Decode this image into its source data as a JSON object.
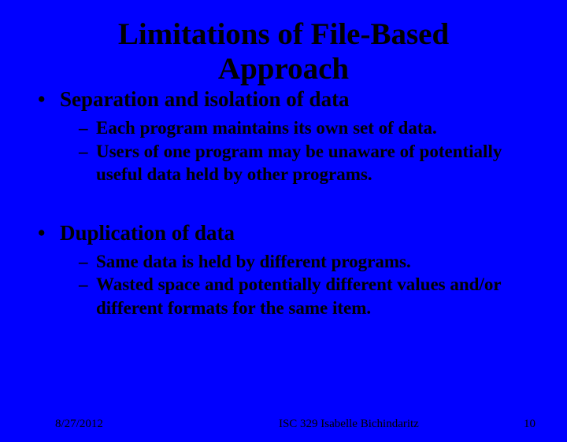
{
  "title_line1": "Limitations of File-Based",
  "title_line2": "Approach",
  "bullets": [
    {
      "heading": "Separation and isolation of data",
      "subs": [
        "Each program maintains its own set of data.",
        "Users of one program may be unaware of potentially useful data held by other programs."
      ]
    },
    {
      "heading": "Duplication of data",
      "subs": [
        "Same data is held by different programs.",
        "Wasted space and potentially different values and/or different formats for the same item."
      ]
    }
  ],
  "footer": {
    "date": "8/27/2012",
    "center": "ISC 329 Isabelle Bichindaritz",
    "page": "10"
  }
}
